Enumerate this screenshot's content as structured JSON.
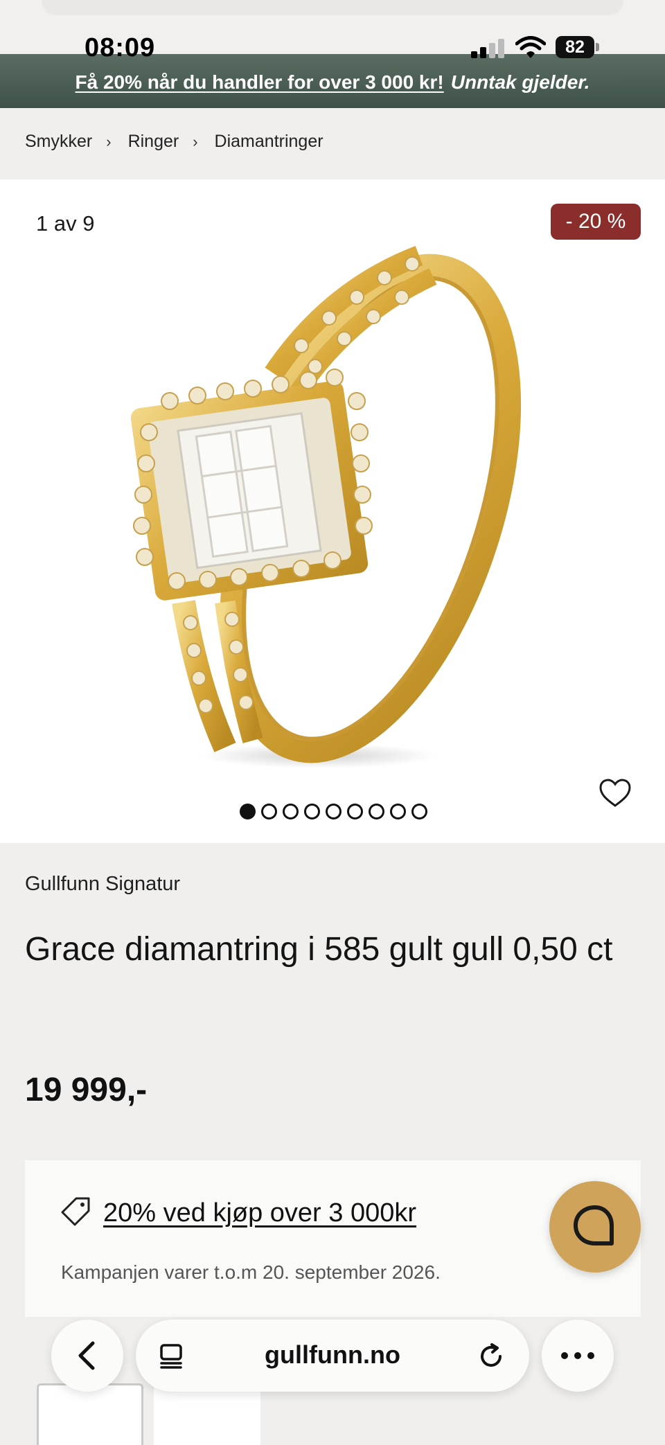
{
  "status_bar": {
    "time": "08:09",
    "battery": "82"
  },
  "promo_banner": {
    "link_text": "Få 20% når du handler for over 3 000 kr!",
    "note": "Unntak gjelder."
  },
  "breadcrumb": [
    "Smykker",
    "Ringer",
    "Diamantringer"
  ],
  "gallery": {
    "counter": "1 av 9",
    "discount_badge": "- 20 %",
    "current_image": 1,
    "image_count": 9
  },
  "product": {
    "brand": "Gullfunn Signatur",
    "title": "Grace diamantring i 585 gult gull 0,50 ct",
    "price": "19 999,-"
  },
  "campaign": {
    "offer": "20% ved kjøp over 3 000kr",
    "validity": "Kampanjen varer t.o.m 20. september 2026."
  },
  "browser": {
    "url": "gullfunn.no"
  },
  "icons": {
    "back": "chevron-left-icon",
    "tabs": "tabs-icon",
    "reload": "reload-icon",
    "more": "more-icon",
    "favorite": "heart-icon",
    "tag": "tag-icon",
    "chat": "chat-icon"
  },
  "colors": {
    "banner": "#4a5c52",
    "badge": "#8b2e2b",
    "chat_button": "#cfa35a",
    "background": "#f0efed"
  }
}
